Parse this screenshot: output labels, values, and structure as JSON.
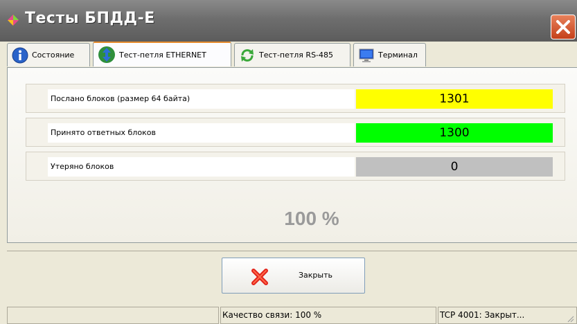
{
  "window": {
    "title": "Тесты БПДД-Е",
    "close_icon": "close-icon"
  },
  "tabs": [
    {
      "label": "Состояние",
      "icon": "info-icon",
      "active": false
    },
    {
      "label": "Тест-петля ETHERNET",
      "icon": "network-icon",
      "active": true
    },
    {
      "label": "Тест-петля RS-485",
      "icon": "loop-arrows-icon",
      "active": false
    },
    {
      "label": "Терминал",
      "icon": "monitor-icon",
      "active": false
    }
  ],
  "stats": [
    {
      "label": "Послано блоков (размер 64 байта)",
      "value": "1301",
      "color": "#ffff00"
    },
    {
      "label": "Принято ответных блоков",
      "value": "1300",
      "color": "#00ff00"
    },
    {
      "label": "Утеряно блоков",
      "value": "0",
      "color": "#c0c0c0"
    }
  ],
  "percent": "100 %",
  "close_button": {
    "label": "Закрыть",
    "icon": "red-x-icon"
  },
  "status": {
    "cell1": "",
    "quality": "Качество связи: 100 %",
    "tcp": "TCP 4001: Закрыт..."
  }
}
